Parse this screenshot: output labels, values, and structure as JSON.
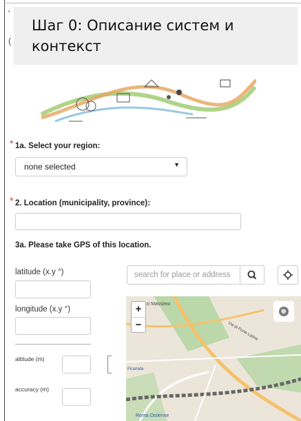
{
  "banner": {
    "title": "Шаг 0: Описание систем и контекст"
  },
  "edge_glyphs": [
    "'",
    "("
  ],
  "form": {
    "region": {
      "label": "1a. Select your region:",
      "required_mark": "*",
      "selected": "none selected"
    },
    "location": {
      "label": "2. Location (municipality, province):",
      "required_mark": "*",
      "value": ""
    },
    "gps": {
      "label": "3a. Please take GPS of this location.",
      "latitude_label": "latitude (x.y °)",
      "longitude_label": "longitude (x.y °)",
      "altitude_label": "altitude (m)",
      "accuracy_label": "accuracy (m)"
    }
  },
  "map": {
    "search_placeholder": "search for place or address",
    "zoom_in": "+",
    "zoom_out": "−",
    "place_labels": [
      "Circo Massimo",
      "Via di Porta Latina",
      "Piramide",
      "Roma Ostiense"
    ],
    "icons": [
      "search-icon",
      "locate-icon",
      "globe-icon"
    ]
  },
  "colors": {
    "required": "#d43f3a",
    "banner_bg": "#efefef",
    "map_park": "#b5d6a3",
    "map_road": "#f5c26b"
  }
}
